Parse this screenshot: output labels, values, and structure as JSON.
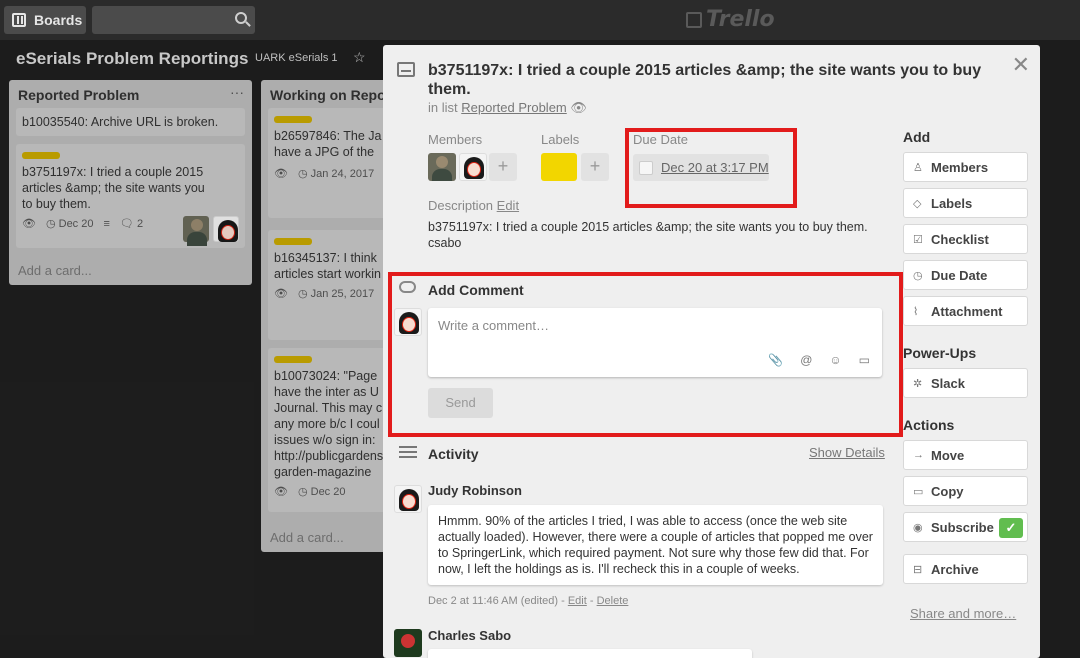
{
  "topbar": {
    "boards_label": "Boards",
    "logo_text": "Trello"
  },
  "board": {
    "title": "eSerials Problem Reportings",
    "team": "UARK eSerials 1"
  },
  "lists": [
    {
      "title": "Reported Problem",
      "cards": [
        {
          "text": "b10035540: Archive URL is broken."
        },
        {
          "text": "b3751197x: I tried a couple 2015 articles &amp; the site wants you to buy them.",
          "date": "Dec 20",
          "comments": "2"
        }
      ],
      "add_card": "Add a card..."
    },
    {
      "title": "Working on Repor",
      "cards": [
        {
          "text": "b26597846: The Ja have a JPG of the",
          "date": "Jan 24, 2017"
        },
        {
          "text": "b16345137: I think articles start workin",
          "date": "Jan 25, 2017"
        },
        {
          "text": "b10073024: \"Page have the inter as U Journal. This may c any more b/c I coul issues w/o sign in: http://publicgardens garden-magazine",
          "date": "Dec 20"
        }
      ],
      "add_card": "Add a card..."
    }
  ],
  "modal": {
    "title": "b3751197x: I tried a couple 2015 articles &amp; the site wants you to buy them.",
    "in_list_prefix": "in list",
    "list_name": "Reported Problem",
    "members_label": "Members",
    "labels_label": "Labels",
    "due_label": "Due Date",
    "due_value": "Dec 20 at 3:17 PM",
    "description_label": "Description",
    "edit_label": "Edit",
    "description": "b3751197x: I tried a couple 2015 articles &amp; the site wants you to buy them.",
    "description_line2": "csabo",
    "add_comment": "Add Comment",
    "comment_placeholder": "Write a comment…",
    "send": "Send",
    "activity": "Activity",
    "show_details": "Show Details",
    "comments": [
      {
        "author": "Judy Robinson",
        "text": "Hmmm. 90% of the articles I tried, I was able to access (once the web site actually loaded). However, there were a couple of articles that popped me over to SpringerLink, which required payment. Not sure why those few did that. For now, I left the holdings as is. I'll recheck this in a couple of weeks.",
        "meta": "Dec 2 at 11:46 AM (edited) -",
        "edit": "Edit",
        "delete": "Delete"
      },
      {
        "author": "Charles Sabo"
      }
    ]
  },
  "sidebar": {
    "add_head": "Add",
    "add_buttons": [
      "Members",
      "Labels",
      "Checklist",
      "Due Date",
      "Attachment"
    ],
    "powerups_head": "Power-Ups",
    "powerups": [
      "Slack"
    ],
    "actions_head": "Actions",
    "actions": [
      "Move",
      "Copy",
      "Subscribe",
      "Archive"
    ],
    "share": "Share and more…"
  },
  "colors": {
    "label_yellow": "#f2d600",
    "highlight_red": "#e21b1b",
    "subscribe_green": "#61bd4f"
  }
}
